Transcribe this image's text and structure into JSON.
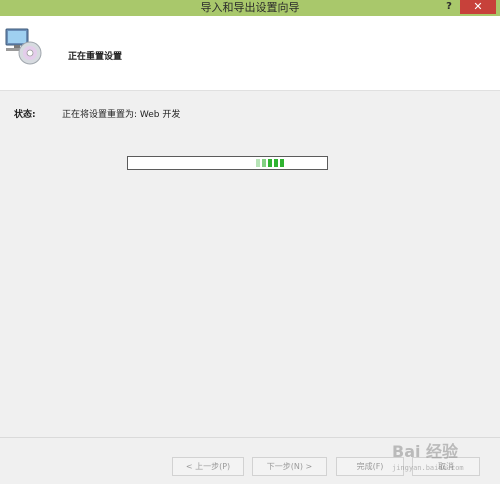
{
  "window": {
    "title": "导入和导出设置向导",
    "help_label": "?",
    "close_label": "✕"
  },
  "header": {
    "title": "正在重置设置",
    "icon": "computer-disc-icon"
  },
  "status": {
    "label": "状态:",
    "text": "正在将设置重置为: Web 开发"
  },
  "progress": {
    "style": "marquee",
    "color": "#30b331"
  },
  "buttons": {
    "back": "< 上一步(P)",
    "next": "下一步(N) >",
    "finish": "完成(F)",
    "cancel": "取消"
  },
  "watermark": {
    "brand": "Bai 经验",
    "url": "jingyan.baidu.com"
  },
  "colors": {
    "titlebar": "#a9c86b",
    "close": "#c7413a",
    "body": "#f0f0f0"
  }
}
